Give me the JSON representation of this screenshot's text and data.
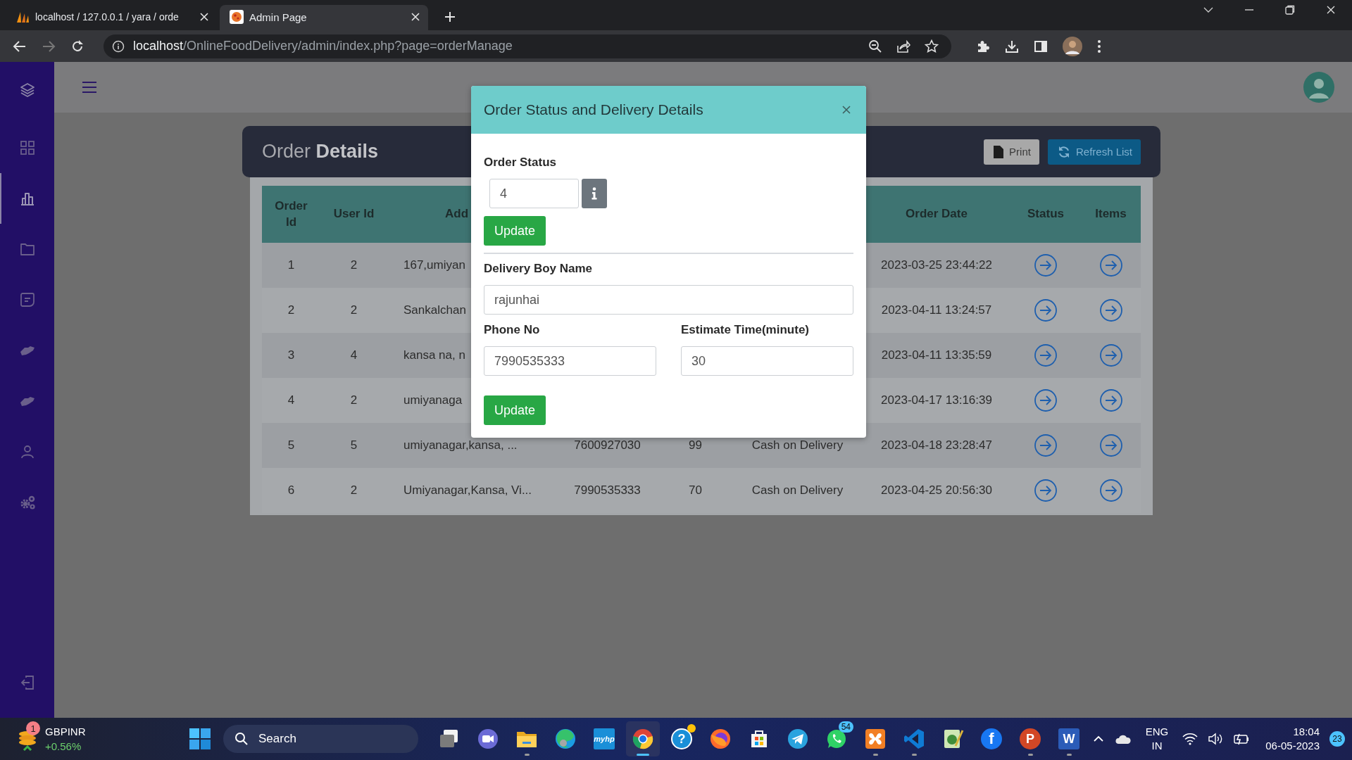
{
  "browser": {
    "tabs": [
      {
        "title": "localhost / 127.0.0.1 / yara / orde",
        "selected": false
      },
      {
        "title": "Admin Page",
        "selected": true
      }
    ],
    "address": {
      "host": "localhost",
      "path": "/OnlineFoodDelivery/admin/index.php?page=orderManage"
    }
  },
  "sidebar": {
    "items": [
      {
        "selected": false
      },
      {
        "selected": true
      },
      {
        "selected": false
      },
      {
        "selected": false
      },
      {
        "selected": false
      },
      {
        "selected": false
      },
      {
        "selected": false
      },
      {
        "selected": false
      }
    ]
  },
  "page": {
    "title": "Order **Details**",
    "buttons": [
      {
        "label": "Print",
        "kind": "print"
      },
      {
        "label": "Refresh List",
        "kind": "refresh"
      }
    ]
  },
  "table": {
    "columns": {
      "order_id": "Order Id",
      "user_id": "User Id",
      "address": "Add",
      "order_date": "Order Date",
      "status": "Status",
      "items": "Items"
    },
    "rows": [
      {
        "order_id": "1",
        "user_id": "2",
        "address": "167,umiyan",
        "order_date": "2023-03-25 23:44:22"
      },
      {
        "order_id": "2",
        "user_id": "2",
        "address": "Sankalchan",
        "order_date": "2023-04-11 13:24:57"
      },
      {
        "order_id": "3",
        "user_id": "4",
        "address": "kansa na, n",
        "order_date": "2023-04-11 13:35:59"
      },
      {
        "order_id": "4",
        "user_id": "2",
        "address": "umiyanaga",
        "order_date": "2023-04-17 13:16:39"
      },
      {
        "order_id": "5",
        "user_id": "5",
        "address": "umiyanagar,kansa, ...",
        "phone_no": "7600927030",
        "amount": "99",
        "payment_mode": "Cash on Delivery",
        "order_date": "2023-04-18 23:28:47"
      },
      {
        "order_id": "6",
        "user_id": "2",
        "address": "Umiyanagar,Kansa, Vi...",
        "phone_no": "7990535333",
        "amount": "70",
        "payment_mode": "Cash on Delivery",
        "order_date": "2023-04-25 20:56:30"
      }
    ]
  },
  "modal": {
    "title": "Order Status and Delivery Details",
    "order_status": {
      "label": "Order Status",
      "value": "4",
      "button": "Update"
    },
    "delivery": {
      "name_label": "Delivery Boy Name",
      "name_value": "rajunhai",
      "phone_label": "Phone No",
      "phone_value": "7990535333",
      "time_label": "Estimate Time(minute)",
      "time_value": "30",
      "button": "Update"
    }
  },
  "taskbar": {
    "widget": {
      "badge": "1",
      "symbol": "GBPINR",
      "change": "+0.56%"
    },
    "search": {
      "placeholder": "Search"
    },
    "apps": [
      {
        "kind": "taskview",
        "running": false,
        "selected": false,
        "alert": false
      },
      {
        "kind": "chat",
        "running": false,
        "selected": false,
        "alert": false
      },
      {
        "kind": "explorer",
        "running": true,
        "selected": false,
        "alert": false
      },
      {
        "kind": "edge",
        "running": false,
        "selected": false,
        "alert": false
      },
      {
        "kind": "myhp",
        "label": "myhp",
        "running": false,
        "selected": false,
        "alert": false
      },
      {
        "kind": "chrome",
        "running": true,
        "selected": true,
        "alert": false
      },
      {
        "kind": "help",
        "label": "?",
        "running": false,
        "selected": false,
        "alert": true
      },
      {
        "kind": "firefox",
        "running": false,
        "selected": false,
        "alert": false
      },
      {
        "kind": "store",
        "running": false,
        "selected": false,
        "alert": false
      },
      {
        "kind": "telegram",
        "running": false,
        "selected": false,
        "alert": false
      },
      {
        "kind": "whatsapp",
        "badge": "54",
        "running": false,
        "selected": false,
        "alert": false
      },
      {
        "kind": "xampp",
        "running": true,
        "selected": false,
        "alert": false
      },
      {
        "kind": "vscode",
        "running": true,
        "selected": false,
        "alert": false
      },
      {
        "kind": "notepad",
        "running": false,
        "selected": false,
        "alert": false
      },
      {
        "kind": "facebook",
        "label": "f",
        "running": false,
        "selected": false,
        "alert": false
      },
      {
        "kind": "powerpoint",
        "label": "P",
        "running": true,
        "selected": false,
        "alert": false
      },
      {
        "kind": "word",
        "label": "W",
        "running": true,
        "selected": false,
        "alert": false
      }
    ],
    "tray": {
      "language": "ENG",
      "region": "IN",
      "time": "18:04",
      "date": "06-05-2023",
      "notifications": "23"
    }
  }
}
